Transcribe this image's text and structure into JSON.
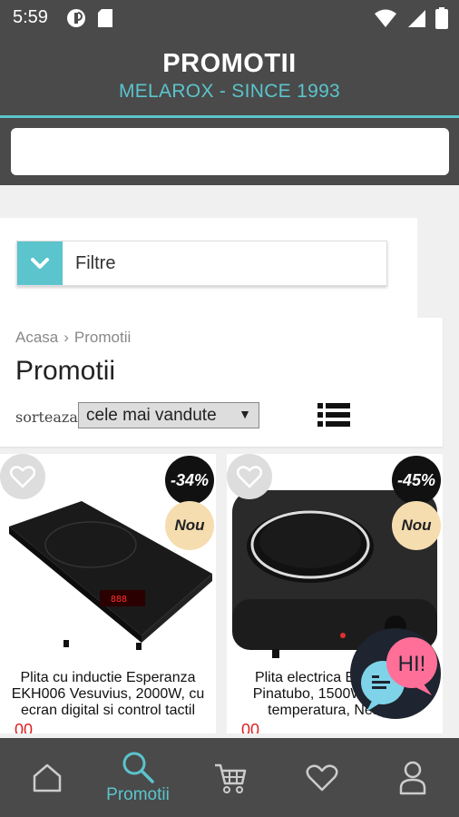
{
  "status_bar": {
    "time": "5:59"
  },
  "header": {
    "title": "PROMOTII",
    "subtitle": "MELAROX - SINCE 1993"
  },
  "search": {
    "placeholder": ""
  },
  "filters": {
    "label": "Filtre"
  },
  "breadcrumb": {
    "home": "Acasa",
    "separator": "›",
    "current": "Promotii"
  },
  "page": {
    "title": "Promotii"
  },
  "sort": {
    "label": "sorteaza",
    "selected": "cele mai vandute",
    "arrow": "▼"
  },
  "products": [
    {
      "name": "Plita cu inductie Esperanza EKH006 Vesuvius, 2000W, cu ecran digital si control tactil",
      "discount": "-34%",
      "badge": "Nou",
      "price": "00"
    },
    {
      "name": "Plita electrica Esperanza Pinatubo, 1500W, reglare temperatura, Neagra",
      "discount": "-45%",
      "badge": "Nou",
      "price": "00"
    }
  ],
  "chat": {
    "label": "HI!"
  },
  "nav": {
    "items": [
      {
        "name": "home-icon"
      },
      {
        "name": "search-icon",
        "label": "Promotii"
      },
      {
        "name": "cart-icon"
      },
      {
        "name": "heart-icon"
      },
      {
        "name": "user-icon"
      }
    ]
  },
  "colors": {
    "accent": "#5bc4cc",
    "header_bg": "#4a4a4a",
    "price": "#d22222"
  }
}
